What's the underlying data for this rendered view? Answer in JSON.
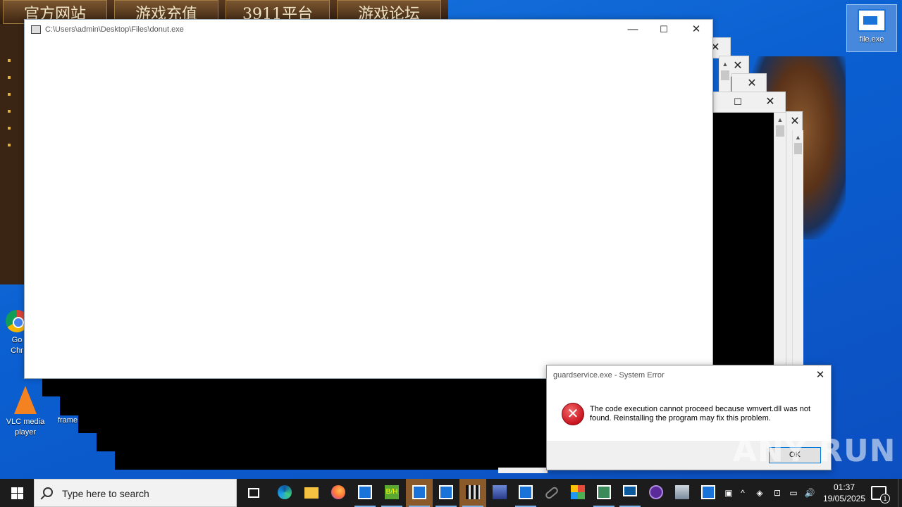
{
  "banner": {
    "tabs": [
      "官方网站",
      "游戏充值",
      "3911平台",
      "游戏论坛"
    ]
  },
  "desktop_icons": {
    "file": "file.exe",
    "chrome_line1": "Go",
    "chrome_line2": "Chr",
    "vlc_line1": "VLC media",
    "vlc_line2": "player",
    "frame": "frame"
  },
  "donut_window": {
    "title": "C:\\Users\\admin\\Desktop\\Files\\donut.exe",
    "minimize": "—",
    "maximize": "☐",
    "close": "✕"
  },
  "ghost_windows": {
    "close": "✕",
    "maximize": "☐"
  },
  "error_dialog": {
    "title": "guardservice.exe - System Error",
    "close": "✕",
    "icon": "✕",
    "message": "The code execution cannot proceed because wmvert.dll was not found. Reinstalling the program may fix this problem.",
    "ok_label": "OK"
  },
  "watermark": "ANY RUN",
  "taskbar": {
    "search_placeholder": "Type here to search",
    "bh_label": "B/H",
    "time": "01:37",
    "date": "19/05/2025",
    "notification_count": "1",
    "tray": {
      "chevron": "^",
      "speaker": "🔊"
    }
  },
  "colors": {
    "taskbar": "#1c1c1c",
    "accent": "#0078d7",
    "error_red": "#c8141e"
  }
}
